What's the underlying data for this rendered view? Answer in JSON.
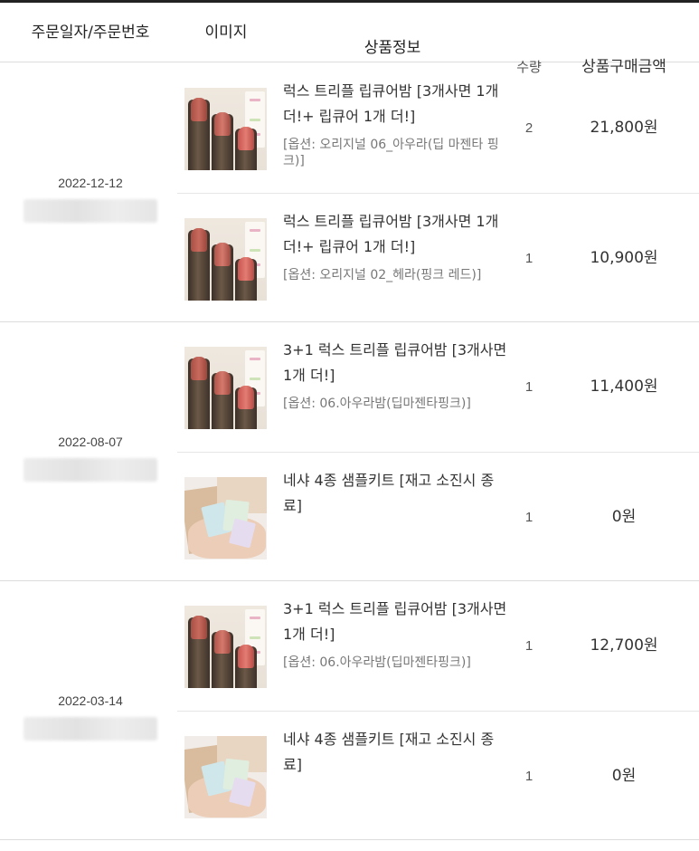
{
  "table": {
    "headers": {
      "date": "주문일자/주문번호",
      "image": "이미지",
      "info": "상품정보",
      "qty": "수량",
      "price": "상품구매금액"
    }
  },
  "orders": [
    {
      "date": "2022-12-12",
      "items": [
        {
          "name": "럭스 트리플 립큐어밤 [3개사면 1개 더!+ 립큐어 1개 더!]",
          "option": "[옵션: 오리지널 06_아우라(딥 마젠타 핑크)]",
          "qty": "2",
          "price": "21,800원",
          "image": "lipstick-product-image"
        },
        {
          "name": "럭스 트리플 립큐어밤 [3개사면 1개 더!+ 립큐어 1개 더!]",
          "option": "[옵션: 오리지널 02_헤라(핑크 레드)]",
          "qty": "1",
          "price": "10,900원",
          "image": "lipstick-product-image"
        }
      ]
    },
    {
      "date": "2022-08-07",
      "items": [
        {
          "name": "3+1 럭스 트리플 립큐어밤 [3개사면 1개 더!]",
          "option": "[옵션: 06.아우라밤(딥마젠타핑크)]",
          "qty": "1",
          "price": "11,400원",
          "image": "lipstick-product-image"
        },
        {
          "name": "네샤 4종 샘플키트 [재고 소진시 종료]",
          "option": "",
          "qty": "1",
          "price": "0원",
          "image": "sample-kit-image"
        }
      ]
    },
    {
      "date": "2022-03-14",
      "items": [
        {
          "name": "3+1 럭스 트리플 립큐어밤 [3개사면 1개 더!]",
          "option": "[옵션: 06.아우라밤(딥마젠타핑크)]",
          "qty": "1",
          "price": "12,700원",
          "image": "lipstick-product-image"
        },
        {
          "name": "네샤 4종 샘플키트 [재고 소진시 종료]",
          "option": "",
          "qty": "1",
          "price": "0원",
          "image": "sample-kit-image"
        }
      ]
    }
  ]
}
